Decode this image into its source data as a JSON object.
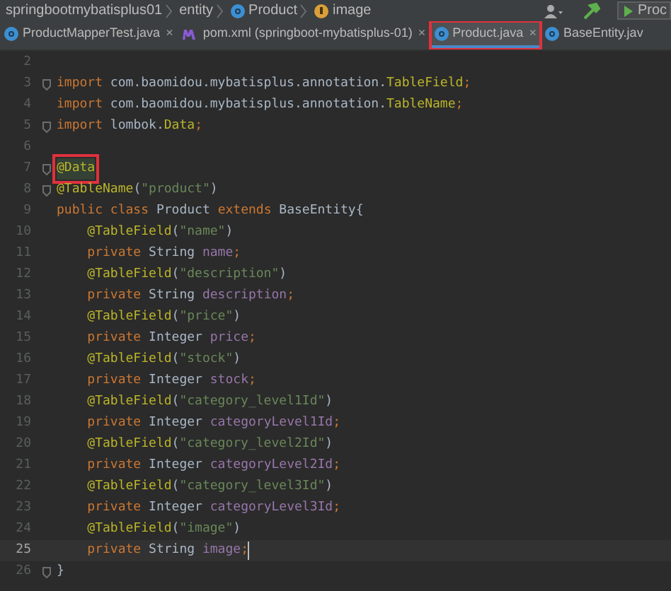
{
  "breadcrumb": [
    {
      "label": "springbootmybatisplus01",
      "kind": "folder"
    },
    {
      "label": "entity",
      "kind": "folder"
    },
    {
      "label": "Product",
      "kind": "class"
    },
    {
      "label": "image",
      "kind": "field"
    }
  ],
  "toolbar": {
    "run_config": "Proc"
  },
  "tabs": [
    {
      "label": "ProductMapperTest.java",
      "kind": "class",
      "selected": false,
      "marked": false,
      "close": "×"
    },
    {
      "label": "pom.xml (springboot-mybatisplus-01)",
      "kind": "maven",
      "selected": false,
      "marked": false,
      "close": "×"
    },
    {
      "label": "Product.java",
      "kind": "class",
      "selected": true,
      "marked": true,
      "close": "×"
    },
    {
      "label": "BaseEntity.jav",
      "kind": "class",
      "selected": false,
      "marked": false
    }
  ],
  "lines": [
    {
      "number": "2",
      "current": false,
      "fold": false
    },
    {
      "number": "3",
      "current": false,
      "fold": true,
      "tokens": [
        {
          "text": "import",
          "kind": "keyword"
        },
        {
          "text": " com.baomidou.mybatisplus.annotation.",
          "kind": "plain"
        },
        {
          "text": "TableField",
          "kind": "annotation"
        },
        {
          "text": ";",
          "kind": "keyword"
        }
      ]
    },
    {
      "number": "4",
      "current": false,
      "fold": false,
      "tokens": [
        {
          "text": "import",
          "kind": "keyword"
        },
        {
          "text": " com.baomidou.mybatisplus.annotation.",
          "kind": "plain"
        },
        {
          "text": "TableName",
          "kind": "annotation"
        },
        {
          "text": ";",
          "kind": "keyword"
        }
      ]
    },
    {
      "number": "5",
      "current": false,
      "fold": true,
      "tokens": [
        {
          "text": "import",
          "kind": "keyword"
        },
        {
          "text": " lombok.",
          "kind": "plain"
        },
        {
          "text": "Data",
          "kind": "annotation"
        },
        {
          "text": ";",
          "kind": "keyword"
        }
      ]
    },
    {
      "number": "6",
      "current": false,
      "fold": false
    },
    {
      "number": "7",
      "current": false,
      "fold": true,
      "tokens": [
        {
          "text": "@Data",
          "kind": "annotation",
          "marked": true
        }
      ]
    },
    {
      "number": "8",
      "current": false,
      "fold": true,
      "tokens": [
        {
          "text": "@TableName",
          "kind": "annotation"
        },
        {
          "text": "(",
          "kind": "plain"
        },
        {
          "text": "\"product\"",
          "kind": "string"
        },
        {
          "text": ")",
          "kind": "plain"
        }
      ]
    },
    {
      "number": "9",
      "current": false,
      "fold": false,
      "tokens": [
        {
          "text": "public class",
          "kind": "keyword"
        },
        {
          "text": " Product ",
          "kind": "plain"
        },
        {
          "text": "extends",
          "kind": "keyword"
        },
        {
          "text": " BaseEntity{",
          "kind": "plain"
        }
      ]
    },
    {
      "number": "10",
      "current": false,
      "fold": false,
      "tokens": [
        {
          "text": "    @TableField",
          "kind": "annotation"
        },
        {
          "text": "(",
          "kind": "plain"
        },
        {
          "text": "\"name\"",
          "kind": "string"
        },
        {
          "text": ")",
          "kind": "plain"
        }
      ]
    },
    {
      "number": "11",
      "current": false,
      "fold": false,
      "tokens": [
        {
          "text": "    private",
          "kind": "keyword"
        },
        {
          "text": " String ",
          "kind": "plain"
        },
        {
          "text": "name",
          "kind": "field"
        },
        {
          "text": ";",
          "kind": "keyword"
        }
      ]
    },
    {
      "number": "12",
      "current": false,
      "fold": false,
      "tokens": [
        {
          "text": "    @TableField",
          "kind": "annotation"
        },
        {
          "text": "(",
          "kind": "plain"
        },
        {
          "text": "\"description\"",
          "kind": "string"
        },
        {
          "text": ")",
          "kind": "plain"
        }
      ]
    },
    {
      "number": "13",
      "current": false,
      "fold": false,
      "tokens": [
        {
          "text": "    private",
          "kind": "keyword"
        },
        {
          "text": " String ",
          "kind": "plain"
        },
        {
          "text": "description",
          "kind": "field"
        },
        {
          "text": ";",
          "kind": "keyword"
        }
      ]
    },
    {
      "number": "14",
      "current": false,
      "fold": false,
      "tokens": [
        {
          "text": "    @TableField",
          "kind": "annotation"
        },
        {
          "text": "(",
          "kind": "plain"
        },
        {
          "text": "\"price\"",
          "kind": "string"
        },
        {
          "text": ")",
          "kind": "plain"
        }
      ]
    },
    {
      "number": "15",
      "current": false,
      "fold": false,
      "tokens": [
        {
          "text": "    private",
          "kind": "keyword"
        },
        {
          "text": " Integer ",
          "kind": "plain"
        },
        {
          "text": "price",
          "kind": "field"
        },
        {
          "text": ";",
          "kind": "keyword"
        }
      ]
    },
    {
      "number": "16",
      "current": false,
      "fold": false,
      "tokens": [
        {
          "text": "    @TableField",
          "kind": "annotation"
        },
        {
          "text": "(",
          "kind": "plain"
        },
        {
          "text": "\"stock\"",
          "kind": "string"
        },
        {
          "text": ")",
          "kind": "plain"
        }
      ]
    },
    {
      "number": "17",
      "current": false,
      "fold": false,
      "tokens": [
        {
          "text": "    private",
          "kind": "keyword"
        },
        {
          "text": " Integer ",
          "kind": "plain"
        },
        {
          "text": "stock",
          "kind": "field"
        },
        {
          "text": ";",
          "kind": "keyword"
        }
      ]
    },
    {
      "number": "18",
      "current": false,
      "fold": false,
      "tokens": [
        {
          "text": "    @TableField",
          "kind": "annotation"
        },
        {
          "text": "(",
          "kind": "plain"
        },
        {
          "text": "\"category_level1Id\"",
          "kind": "string"
        },
        {
          "text": ")",
          "kind": "plain"
        }
      ]
    },
    {
      "number": "19",
      "current": false,
      "fold": false,
      "tokens": [
        {
          "text": "    private",
          "kind": "keyword"
        },
        {
          "text": " Integer ",
          "kind": "plain"
        },
        {
          "text": "categoryLevel1Id",
          "kind": "field"
        },
        {
          "text": ";",
          "kind": "keyword"
        }
      ]
    },
    {
      "number": "20",
      "current": false,
      "fold": false,
      "tokens": [
        {
          "text": "    @TableField",
          "kind": "annotation"
        },
        {
          "text": "(",
          "kind": "plain"
        },
        {
          "text": "\"category_level2Id\"",
          "kind": "string"
        },
        {
          "text": ")",
          "kind": "plain"
        }
      ]
    },
    {
      "number": "21",
      "current": false,
      "fold": false,
      "tokens": [
        {
          "text": "    private",
          "kind": "keyword"
        },
        {
          "text": " Integer ",
          "kind": "plain"
        },
        {
          "text": "categoryLevel2Id",
          "kind": "field"
        },
        {
          "text": ";",
          "kind": "keyword"
        }
      ]
    },
    {
      "number": "22",
      "current": false,
      "fold": false,
      "tokens": [
        {
          "text": "    @TableField",
          "kind": "annotation"
        },
        {
          "text": "(",
          "kind": "plain"
        },
        {
          "text": "\"category_level3Id\"",
          "kind": "string"
        },
        {
          "text": ")",
          "kind": "plain"
        }
      ]
    },
    {
      "number": "23",
      "current": false,
      "fold": false,
      "tokens": [
        {
          "text": "    private",
          "kind": "keyword"
        },
        {
          "text": " Integer ",
          "kind": "plain"
        },
        {
          "text": "categoryLevel3Id",
          "kind": "field"
        },
        {
          "text": ";",
          "kind": "keyword"
        }
      ]
    },
    {
      "number": "24",
      "current": false,
      "fold": false,
      "tokens": [
        {
          "text": "    @TableField",
          "kind": "annotation"
        },
        {
          "text": "(",
          "kind": "plain"
        },
        {
          "text": "\"image\"",
          "kind": "string"
        },
        {
          "text": ")",
          "kind": "plain"
        }
      ]
    },
    {
      "number": "25",
      "current": true,
      "fold": false,
      "tokens": [
        {
          "text": "    private",
          "kind": "keyword"
        },
        {
          "text": " String ",
          "kind": "plain"
        },
        {
          "text": "image",
          "kind": "field"
        },
        {
          "text": ";",
          "kind": "keyword"
        }
      ]
    },
    {
      "number": "26",
      "current": false,
      "fold": true,
      "tokens": [
        {
          "text": "}",
          "kind": "plain"
        }
      ]
    }
  ]
}
